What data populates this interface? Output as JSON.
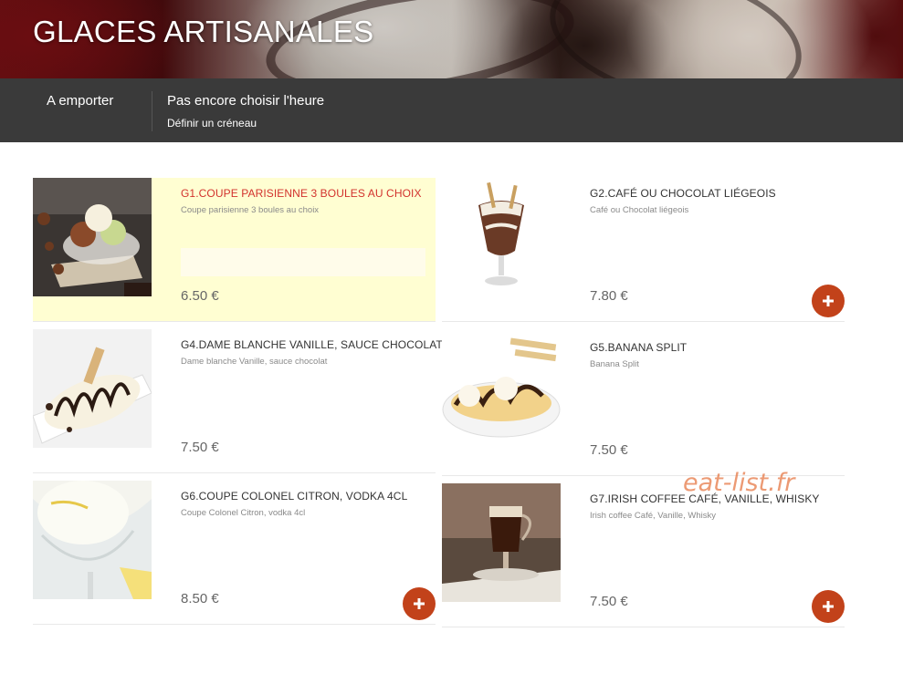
{
  "header": {
    "title": "GLACES ARTISANALES"
  },
  "nav": {
    "mode_label": "A emporter",
    "time_title": "Pas encore choisir l'heure",
    "time_link": "Définir un créneau"
  },
  "products": [
    {
      "name": "G1.COUPE PARISIENNE 3 BOULES AU CHOIX",
      "description": "Coupe parisienne 3 boules au choix",
      "price": "6.50 €",
      "image": "sundae-three-scoops"
    },
    {
      "name": "G2.CAFÉ OU CHOCOLAT LIÉGEOIS",
      "description": "Café ou Chocolat liégeois",
      "price": "7.80 €",
      "image": "chocolate-liegeois-glass"
    },
    {
      "name": "G4.DAME BLANCHE VANILLE, SAUCE CHOCOLAT",
      "description": "Dame blanche Vanille, sauce chocolat",
      "price": "7.50 €",
      "image": "dame-blanche"
    },
    {
      "name": "G5.BANANA SPLIT",
      "description": "Banana Split",
      "price": "7.50 €",
      "image": "banana-split"
    },
    {
      "name": "G6.COUPE COLONEL CITRON, VODKA 4CL",
      "description": "Coupe Colonel Citron, vodka 4cl",
      "price": "8.50 €",
      "image": "colonel-citron"
    },
    {
      "name": "G7.IRISH COFFEE CAFÉ, VANILLE, WHISKY",
      "description": "Irish coffee Café, Vanille, Whisky",
      "price": "7.50 €",
      "image": "irish-coffee"
    }
  ],
  "watermark": "eat-list.fr",
  "colors": {
    "nav_background": "#3a3a3a",
    "highlight_background": "#fffed2",
    "highlight_title": "#d2322d",
    "add_button": "#c2421a"
  },
  "icons": {
    "add": "plus-icon"
  }
}
